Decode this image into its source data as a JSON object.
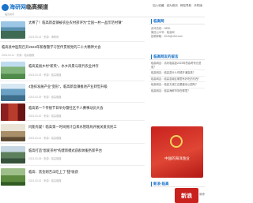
{
  "header": {
    "logo_text": "海研网",
    "logo_sub": "临高资讯",
    "title": "临高频道",
    "nav": [
      "加入收藏",
      "设为首页",
      "网站导航",
      "手机版"
    ]
  },
  "news": [
    {
      "title": "太棒了！临高新盈镇被农业农村部评为“全国一村一品示范村镇”",
      "meta": "2023-05-23 · 来源：海研网"
    },
    {
      "title": "临高县中医院召开2023年新春暨学习宣传贯彻党的二十大精神大会",
      "meta": "2023-04-11 · 来源：临高融媒"
    },
    {
      "title": "临高美丽乡村“新英”，水乡风景与现代农业并存",
      "meta": "2023-04-03 · 来源：临高融媒"
    },
    {
      "title": "4渔排发展产业“变形”，临高新盈镇推进产业转型升级",
      "meta": "2023-03-29 · 来源：临高融媒"
    },
    {
      "title": "临高第一个传统节日举办暨社区千人赛事动员大会",
      "meta": "2023-03-20 · 来源：临高融媒"
    },
    {
      "title": "问能有疑！临高第一时间统计自来水管理局开展关爱农民工",
      "meta": "2023-03-14 · 来源：临高融媒"
    },
    {
      "title": "临高打造“恩爱茶村”构建新模式获群体服务新平台",
      "meta": "2023-03-09 · 来源：临高融媒"
    },
    {
      "title": "临高：黑金刚苦瓜吃上了“甜”收获",
      "meta": "2023-03-02 · 来源：临高融媒"
    }
  ],
  "sidebar": {
    "panel1_title": "临高网",
    "panel1_rows": [
      "资讯热线：0898-",
      "微信公众号：临高网",
      "投稿邮箱：2015@163.com"
    ],
    "panel2_title": "临高网友的留言",
    "panel2_items": [
      "临高网友：请问临高县2023年的高考状元是谁？",
      "临高网友：临高县什么时候开通高铁？",
      "临高网友：临高县城区哪里有好吃的东西？",
      "临高网友：临高文澜江边要建设公园吗？",
      "临高网友：临高海鲜市场在哪里？"
    ],
    "banner_text": "中国的海洋渔业",
    "panel3_title": "新浪·临高",
    "panel3_badge": "新浪",
    "panel3_side": "微博"
  },
  "colors": {
    "accent": "#1a73c9"
  }
}
